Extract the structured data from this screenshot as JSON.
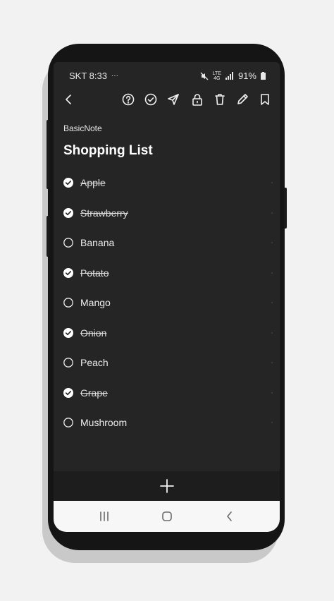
{
  "status_bar": {
    "carrier_time": "SKT 8:33",
    "extra": "···",
    "network_top": "LTE",
    "network_bottom": "4G",
    "battery": "91%"
  },
  "toolbar": {
    "icons": [
      "back-arrow-icon",
      "help-icon",
      "check-circle-icon",
      "send-icon",
      "lock-icon",
      "trash-icon",
      "pencil-icon",
      "bookmark-icon"
    ]
  },
  "app": {
    "name": "BasicNote"
  },
  "note": {
    "title": "Shopping List",
    "items": [
      {
        "label": "Apple",
        "checked": true
      },
      {
        "label": "Strawberry",
        "checked": true
      },
      {
        "label": "Banana",
        "checked": false
      },
      {
        "label": "Potato",
        "checked": true
      },
      {
        "label": "Mango",
        "checked": false
      },
      {
        "label": "Onion",
        "checked": true
      },
      {
        "label": "Peach",
        "checked": false
      },
      {
        "label": "Grape",
        "checked": true
      },
      {
        "label": "Mushroom",
        "checked": false
      }
    ]
  },
  "bottom_bar": {
    "add_icon": "plus-icon"
  },
  "nav_bar": {
    "icons": [
      "recent-apps-icon",
      "home-icon",
      "back-icon"
    ]
  },
  "colors": {
    "screen_bg": "#252525",
    "text": "#ededed",
    "nav_bg": "#f7f7f7"
  }
}
